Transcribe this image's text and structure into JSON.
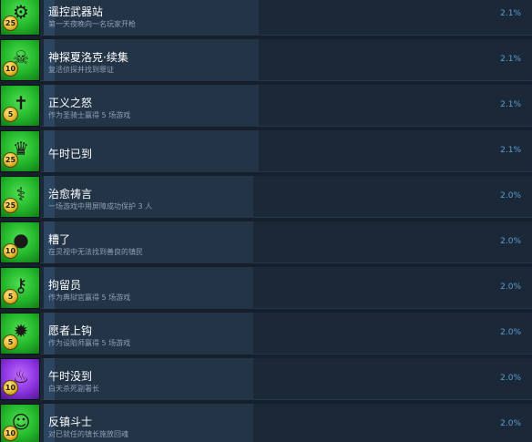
{
  "achievements": [
    {
      "title": "遥控武器站",
      "description": "第一天夜晚向一名玩家开枪",
      "percent": "2.1%",
      "points": "25",
      "icon": "gatling-turret-icon",
      "color": "green",
      "progress": 0.44
    },
    {
      "title": "神探夏洛克·续集",
      "description": "复活侦探并找到罪证",
      "percent": "2.1%",
      "points": "10",
      "icon": "ghost-detective-icon",
      "color": "green",
      "progress": 0.44
    },
    {
      "title": "正义之怒",
      "description": "作为圣骑士赢得 5 场游戏",
      "percent": "2.1%",
      "points": "5",
      "icon": "holy-cross-icon",
      "color": "green",
      "progress": 0.44
    },
    {
      "title": "午时已到",
      "description": "",
      "percent": "2.1%",
      "points": "25",
      "icon": "demon-crown-icon",
      "color": "green",
      "progress": 0.44
    },
    {
      "title": "治愈祷言",
      "description": "一场游戏中用屏障成功保护 3 人",
      "percent": "2.0%",
      "points": "25",
      "icon": "caduceus-icon",
      "color": "green",
      "progress": 0.43
    },
    {
      "title": "糟了",
      "description": "在灵视中无法找到善良的镇民",
      "percent": "2.0%",
      "points": "10",
      "icon": "crystal-ball-icon",
      "color": "green",
      "progress": 0.43
    },
    {
      "title": "拘留员",
      "description": "作为典狱官赢得 5 场游戏",
      "percent": "2.0%",
      "points": "5",
      "icon": "cell-keys-icon",
      "color": "green",
      "progress": 0.43
    },
    {
      "title": "愿者上钩",
      "description": "作为设陷师赢得 5 场游戏",
      "percent": "2.0%",
      "points": "5",
      "icon": "bear-trap-icon",
      "color": "green",
      "progress": 0.43
    },
    {
      "title": "午时没到",
      "description": "白天杀死副署长",
      "percent": "2.0%",
      "points": "10",
      "icon": "dark-flame-icon",
      "color": "purple",
      "progress": 0.43
    },
    {
      "title": "反镇斗士",
      "description": "对已就任的镇长施放回魂",
      "percent": "2.0%",
      "points": "10",
      "icon": "jester-mask-icon",
      "color": "green",
      "progress": 0.43
    }
  ]
}
